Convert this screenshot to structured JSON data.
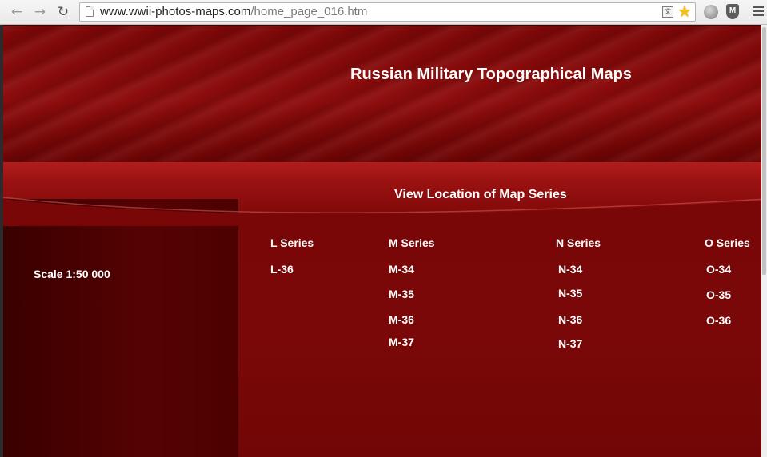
{
  "browser": {
    "back_icon": "arrow-left-icon",
    "forward_icon": "arrow-right-icon",
    "reload_icon": "reload-icon",
    "url_host": "www.wwii-photos-maps.com",
    "url_path": "/home_page_016.htm",
    "translate_icon": "translate-icon",
    "star_icon": "star-icon",
    "menu_icon": "hamburger-menu-icon"
  },
  "page": {
    "title": "Russian Military Topographical Maps",
    "nav_caption": "View Location of Map Series",
    "scale_label": "Scale 1:50 000",
    "series": [
      {
        "header": "L Series",
        "items": [
          "L-36"
        ]
      },
      {
        "header": "M Series",
        "items": [
          "M-34",
          "M-35",
          "M-36",
          "M-37"
        ]
      },
      {
        "header": "N Series",
        "items": [
          "N-34",
          "N-35",
          "N-36",
          "N-37"
        ]
      },
      {
        "header": "O Series",
        "items": [
          "O-34",
          "O-35",
          "O-36"
        ]
      }
    ]
  },
  "colors": {
    "banner_red": "#8d0c0c",
    "content_red": "#7a0808",
    "sidebar_dark": "#4d0101",
    "text": "#ffffff"
  }
}
